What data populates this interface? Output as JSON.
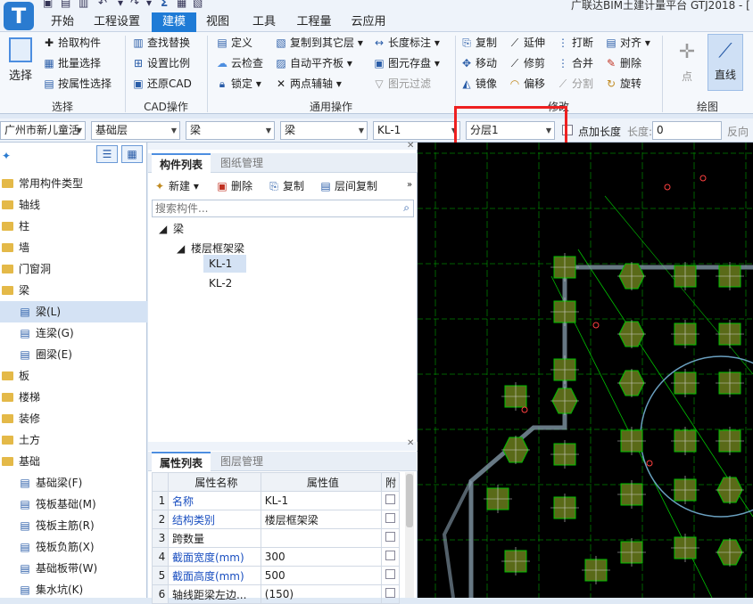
{
  "app": {
    "title": "广联达BIM土建计量平台 GTJ2018 - [",
    "logo_letter": "T"
  },
  "tabs": [
    {
      "label": "开始"
    },
    {
      "label": "工程设置"
    },
    {
      "label": "建模"
    },
    {
      "label": "视图"
    },
    {
      "label": "工具"
    },
    {
      "label": "工程量"
    },
    {
      "label": "云应用"
    }
  ],
  "ribbon": {
    "select": {
      "big_label": "选择",
      "pick": "拾取构件",
      "batch": "批量选择",
      "by_attr": "按属性选择",
      "group": "选择"
    },
    "cad": {
      "find_replace": "查找替换",
      "set_scale": "设置比例",
      "restore_cad": "还原CAD",
      "group": "CAD操作"
    },
    "general": {
      "define": "定义",
      "copy_layer": "复制到其它层",
      "length_mark": "长度标注",
      "cloud_check": "云检查",
      "auto_align": "自动平齐板",
      "save_drawing": "图元存盘",
      "lock": "锁定",
      "two_point": "两点辅轴",
      "filter": "图元过滤",
      "group": "通用操作"
    },
    "modify": {
      "copy": "复制",
      "extend": "延伸",
      "break": "打断",
      "align": "对齐",
      "move": "移动",
      "trim": "修剪",
      "merge": "合并",
      "delete": "删除",
      "mirror": "镜像",
      "offset": "偏移",
      "split": "分割",
      "rotate": "旋转",
      "group": "修改"
    },
    "draw": {
      "point": "点",
      "line": "直线",
      "group": "绘图"
    }
  },
  "combobar": {
    "project": "广州市新儿童活",
    "floor": "基础层",
    "category": "梁",
    "type": "梁",
    "member": "KL-1",
    "sublayer": "分层1",
    "add_length_label": "点加长度",
    "length_label": "长度:",
    "length_value": "0",
    "reverse": "反向"
  },
  "nav_tree": [
    {
      "label": "常用构件类型",
      "kind": "folder"
    },
    {
      "label": "轴线",
      "kind": "folder"
    },
    {
      "label": "柱",
      "kind": "folder"
    },
    {
      "label": "墙",
      "kind": "folder"
    },
    {
      "label": "门窗洞",
      "kind": "folder"
    },
    {
      "label": "梁",
      "kind": "folder-open"
    },
    {
      "label": "梁(L)",
      "kind": "child",
      "icon": "梁"
    },
    {
      "label": "连梁(G)",
      "kind": "child",
      "icon": "连"
    },
    {
      "label": "圈梁(E)",
      "kind": "child",
      "icon": "圈"
    },
    {
      "label": "板",
      "kind": "folder"
    },
    {
      "label": "楼梯",
      "kind": "folder"
    },
    {
      "label": "装修",
      "kind": "folder"
    },
    {
      "label": "土方",
      "kind": "folder"
    },
    {
      "label": "基础",
      "kind": "folder-open"
    },
    {
      "label": "基础梁(F)",
      "kind": "child",
      "icon": "基"
    },
    {
      "label": "筏板基础(M)",
      "kind": "child",
      "icon": "筏"
    },
    {
      "label": "筏板主筋(R)",
      "kind": "child",
      "icon": "主"
    },
    {
      "label": "筏板负筋(X)",
      "kind": "child",
      "icon": "负"
    },
    {
      "label": "基础板带(W)",
      "kind": "child",
      "icon": "带"
    },
    {
      "label": "集水坑(K)",
      "kind": "child",
      "icon": "坑"
    }
  ],
  "component_panel": {
    "tab_components": "构件列表",
    "tab_drawings": "图纸管理",
    "new": "新建",
    "delete": "删除",
    "copy": "复制",
    "floor_copy": "层间复制",
    "search_placeholder": "搜索构件...",
    "root": "梁",
    "sub": "楼层框架梁",
    "items": [
      "KL-1",
      "KL-2"
    ]
  },
  "property_panel": {
    "tab_props": "属性列表",
    "tab_layers": "图层管理",
    "col_name": "属性名称",
    "col_value": "属性值",
    "col_extra": "附",
    "rows": [
      {
        "no": "1",
        "name": "名称",
        "value": "KL-1"
      },
      {
        "no": "2",
        "name": "结构类别",
        "value": "楼层框架梁"
      },
      {
        "no": "3",
        "name": "跨数量",
        "value": ""
      },
      {
        "no": "4",
        "name": "截面宽度(mm)",
        "value": "300"
      },
      {
        "no": "5",
        "name": "截面高度(mm)",
        "value": "500"
      },
      {
        "no": "6",
        "name": "轴线距梁左边...",
        "value": "(150)"
      }
    ]
  },
  "colors": {
    "accent": "#1f7bd6",
    "highlight": "#ee2020",
    "canvas": "#000000",
    "cad_green": "#00c000",
    "cad_column": "#5a6a18"
  }
}
